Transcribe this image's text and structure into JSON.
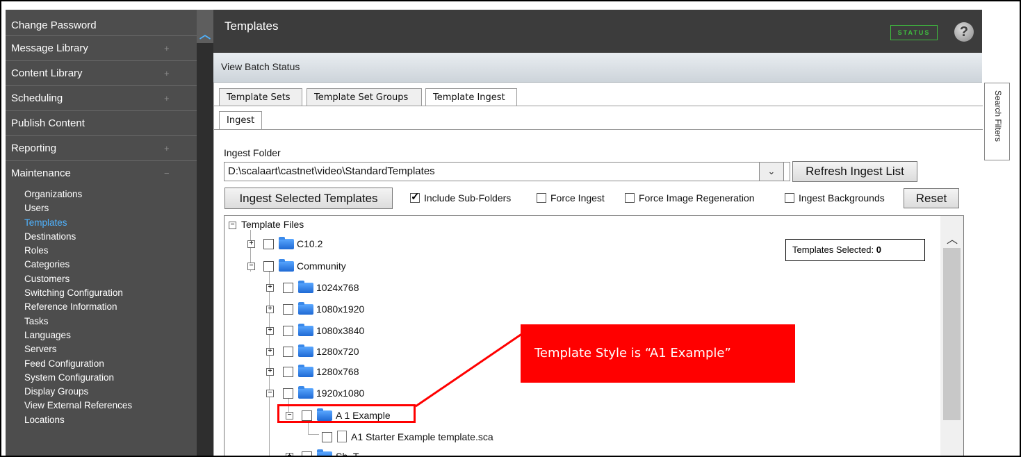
{
  "sidebar": {
    "items": [
      {
        "label": "Change Password",
        "expander": ""
      },
      {
        "label": "Message Library",
        "expander": "+"
      },
      {
        "label": "Content Library",
        "expander": "+"
      },
      {
        "label": "Scheduling",
        "expander": "+"
      },
      {
        "label": "Publish Content",
        "expander": ""
      },
      {
        "label": "Reporting",
        "expander": "+"
      },
      {
        "label": "Maintenance",
        "expander": "−"
      }
    ],
    "subitems": [
      "Organizations",
      "Users",
      "Templates",
      "Destinations",
      "Roles",
      "Categories",
      "Customers",
      "Switching Configuration",
      "Reference Information",
      "Tasks",
      "Languages",
      "Servers",
      "Feed Configuration",
      "System Configuration",
      "Display Groups",
      "View External References",
      "Locations"
    ],
    "active_subitem": "Templates"
  },
  "header": {
    "title": "Templates",
    "status_label": "STATUS",
    "help_icon": "?"
  },
  "subheader": {
    "batch_label": "View Batch Status"
  },
  "tabs": {
    "template_sets": "Template Sets",
    "template_set_groups": "Template Set Groups",
    "template_ingest": "Template Ingest",
    "ingest": "Ingest"
  },
  "ingest": {
    "folder_label": "Ingest Folder",
    "folder_value": "D:\\scalaart\\castnet\\video\\StandardTemplates",
    "refresh_label": "Refresh Ingest List",
    "ingest_selected_label": "Ingest Selected Templates",
    "include_sub_folders": "Include Sub-Folders",
    "force_ingest": "Force Ingest",
    "force_image_regeneration": "Force Image Regeneration",
    "ingest_backgrounds": "Ingest Backgrounds",
    "reset_label": "Reset"
  },
  "tree": {
    "root": "Template Files",
    "nodes": {
      "c10": "C10.2",
      "community": "Community",
      "f1024x768": "1024x768",
      "f1080x1920": "1080x1920",
      "f1080x3840": "1080x3840",
      "f1280x720": "1280x720",
      "f1280x768": "1280x768",
      "f1920x1080": "1920x1080",
      "a1example": "A 1 Example",
      "starter": "A1 Starter Example template.sca",
      "partial": "Sh_T..."
    },
    "templates_selected_label": "Templates Selected:",
    "templates_selected_count": "0"
  },
  "search_filters_label": "Search Filters",
  "callout": {
    "text": "Template Style is “A1 Example”"
  },
  "colors": {
    "sidebar_bg": "#4d4d4d",
    "active_link": "#4fb3ff",
    "status_green": "#3fbf3f",
    "callout_red": "#ff0000"
  }
}
